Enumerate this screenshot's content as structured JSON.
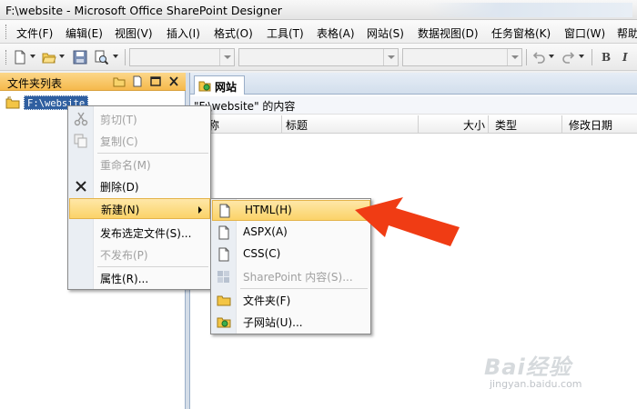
{
  "window": {
    "title": "F:\\website - Microsoft Office SharePoint Designer"
  },
  "menubar": {
    "items": [
      {
        "label": "文件(F)"
      },
      {
        "label": "编辑(E)"
      },
      {
        "label": "视图(V)"
      },
      {
        "label": "插入(I)"
      },
      {
        "label": "格式(O)"
      },
      {
        "label": "工具(T)"
      },
      {
        "label": "表格(A)"
      },
      {
        "label": "网站(S)"
      },
      {
        "label": "数据视图(D)"
      },
      {
        "label": "任务窗格(K)"
      },
      {
        "label": "窗口(W)"
      },
      {
        "label": "帮助"
      }
    ]
  },
  "toolbar": {
    "icons": [
      "new-page-icon",
      "open-folder-icon",
      "save-icon",
      "preview-icon",
      "undo-icon",
      "redo-icon"
    ],
    "format_buttons": [
      "B",
      "I"
    ]
  },
  "folder_panel": {
    "title": "文件夹列表",
    "root_label": "F:\\website"
  },
  "site_panel": {
    "tab_label": "网站",
    "content_label": "\"F:\\website\" 的内容",
    "columns": [
      "称",
      "标题",
      "大小",
      "类型",
      "修改日期"
    ]
  },
  "context_menu": {
    "items": [
      {
        "label": "剪切(T)",
        "disabled": true,
        "icon": "scissors-icon"
      },
      {
        "label": "复制(C)",
        "disabled": true,
        "icon": "copy-icon"
      },
      {
        "label": "重命名(M)",
        "disabled": true
      },
      {
        "label": "删除(D)",
        "disabled": false,
        "icon": "delete-x-icon"
      },
      {
        "label": "新建(N)",
        "disabled": false,
        "highlighted": true,
        "submenu": true
      },
      {
        "label": "发布选定文件(S)...",
        "disabled": false
      },
      {
        "label": "不发布(P)",
        "disabled": true
      },
      {
        "label": "属性(R)...",
        "disabled": false
      }
    ]
  },
  "submenu": {
    "items": [
      {
        "label": "HTML(H)",
        "highlighted": true,
        "icon": "page-icon"
      },
      {
        "label": "ASPX(A)",
        "icon": "page-icon"
      },
      {
        "label": "CSS(C)",
        "icon": "page-icon"
      },
      {
        "label": "SharePoint 内容(S)...",
        "disabled": true,
        "icon": "sharepoint-icon"
      },
      {
        "label": "文件夹(F)",
        "icon": "folder-icon"
      },
      {
        "label": "子网站(U)...",
        "icon": "subsite-icon"
      }
    ]
  },
  "annotation": {
    "color": "#f03c14"
  },
  "watermark": {
    "brand": "Bai经验",
    "url": "jingyan.baidu.com"
  },
  "colors": {
    "highlight": "#fbd368",
    "panel_header": "#f5b94c",
    "selection": "#2f5fa0"
  }
}
